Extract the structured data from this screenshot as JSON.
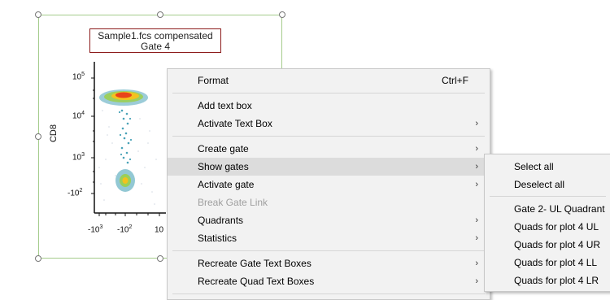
{
  "plot": {
    "title_line1": "Sample1.fcs compensated",
    "title_line2": "Gate 4",
    "y_axis_label": "CD8",
    "y_ticks": [
      {
        "base": "10",
        "exp": "5"
      },
      {
        "base": "10",
        "exp": "4"
      },
      {
        "base": "10",
        "exp": "3"
      },
      {
        "base": "-10",
        "exp": "2"
      }
    ],
    "x_ticks": [
      {
        "base": "-10",
        "exp": "3"
      },
      {
        "base": "-10",
        "exp": "2"
      },
      {
        "base": "10",
        "exp": ""
      }
    ]
  },
  "context_menu": {
    "items": [
      {
        "label": "Format",
        "shortcut": "Ctrl+F",
        "submenu": false,
        "disabled": false
      },
      {
        "label": "Add text box",
        "submenu": false,
        "disabled": false
      },
      {
        "label": "Activate Text Box",
        "submenu": true,
        "disabled": false
      },
      {
        "label": "Create gate",
        "submenu": true,
        "disabled": false
      },
      {
        "label": "Show gates",
        "submenu": true,
        "disabled": false,
        "highlighted": true
      },
      {
        "label": "Activate gate",
        "submenu": true,
        "disabled": false
      },
      {
        "label": "Break Gate Link",
        "submenu": false,
        "disabled": true
      },
      {
        "label": "Quadrants",
        "submenu": true,
        "disabled": false
      },
      {
        "label": "Statistics",
        "submenu": true,
        "disabled": false
      },
      {
        "label": "Recreate Gate Text Boxes",
        "submenu": true,
        "disabled": false
      },
      {
        "label": "Recreate Quad Text Boxes",
        "submenu": true,
        "disabled": false
      }
    ],
    "arrow_glyph": "›"
  },
  "submenu": {
    "items": [
      {
        "label": "Select all"
      },
      {
        "label": "Deselect all"
      },
      {
        "label": "Gate 2- UL Quadrant"
      },
      {
        "label": "Quads for plot 4 UL"
      },
      {
        "label": "Quads for plot 4 UR"
      },
      {
        "label": "Quads for plot 4 LL"
      },
      {
        "label": "Quads for plot 4 LR"
      }
    ]
  },
  "colors": {
    "frame_border": "#a5cc8c",
    "title_border": "#8b1a1a",
    "menu_bg": "#f2f2f2",
    "highlight_bg": "#dcdcdc",
    "disabled_text": "#a0a0a0"
  }
}
